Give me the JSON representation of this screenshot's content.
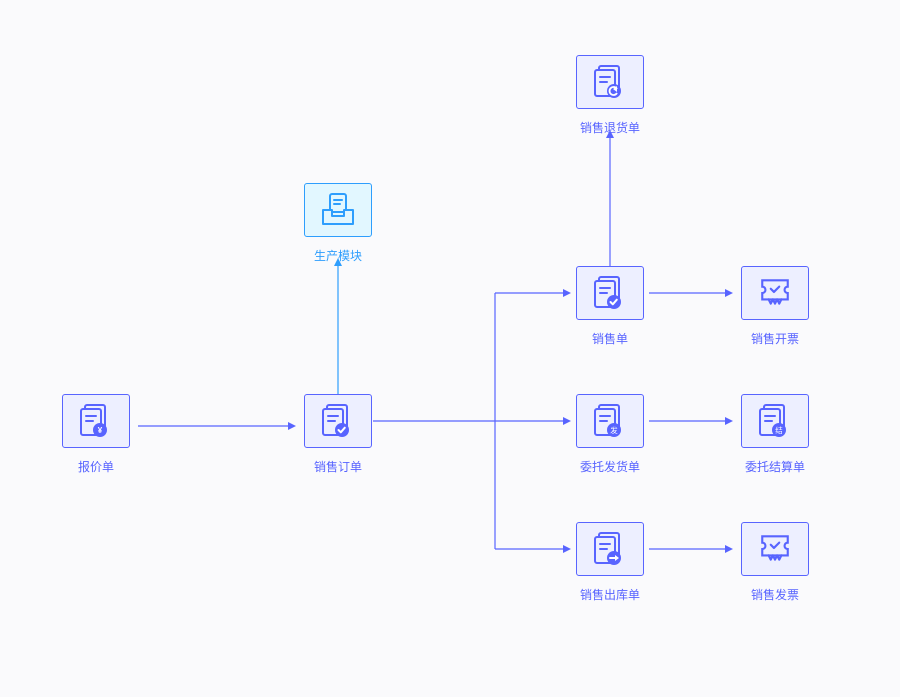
{
  "nodes": {
    "quote": {
      "label": "报价单",
      "interactable": true
    },
    "salesOrder": {
      "label": "销售订单",
      "interactable": true
    },
    "production": {
      "label": "生产模块",
      "interactable": true
    },
    "salesReturn": {
      "label": "销售退货单",
      "interactable": true
    },
    "salesBill": {
      "label": "销售单",
      "interactable": true
    },
    "salesInvoice": {
      "label": "销售开票",
      "interactable": true
    },
    "consignShip": {
      "label": "委托发货单",
      "interactable": true
    },
    "consignSettle": {
      "label": "委托结算单",
      "interactable": true
    },
    "salesOut": {
      "label": "销售出库单",
      "interactable": true
    },
    "salesReceipt": {
      "label": "销售发票",
      "interactable": true
    }
  },
  "edges": [
    {
      "from": "quote",
      "to": "salesOrder"
    },
    {
      "from": "salesOrder",
      "to": "production"
    },
    {
      "from": "salesOrder",
      "to": "salesBill"
    },
    {
      "from": "salesOrder",
      "to": "consignShip"
    },
    {
      "from": "salesOrder",
      "to": "salesOut"
    },
    {
      "from": "salesBill",
      "to": "salesReturn"
    },
    {
      "from": "salesBill",
      "to": "salesInvoice"
    },
    {
      "from": "consignShip",
      "to": "consignSettle"
    },
    {
      "from": "salesOut",
      "to": "salesReceipt"
    }
  ],
  "badges": {
    "consignShip": "发",
    "consignSettle": "结"
  }
}
